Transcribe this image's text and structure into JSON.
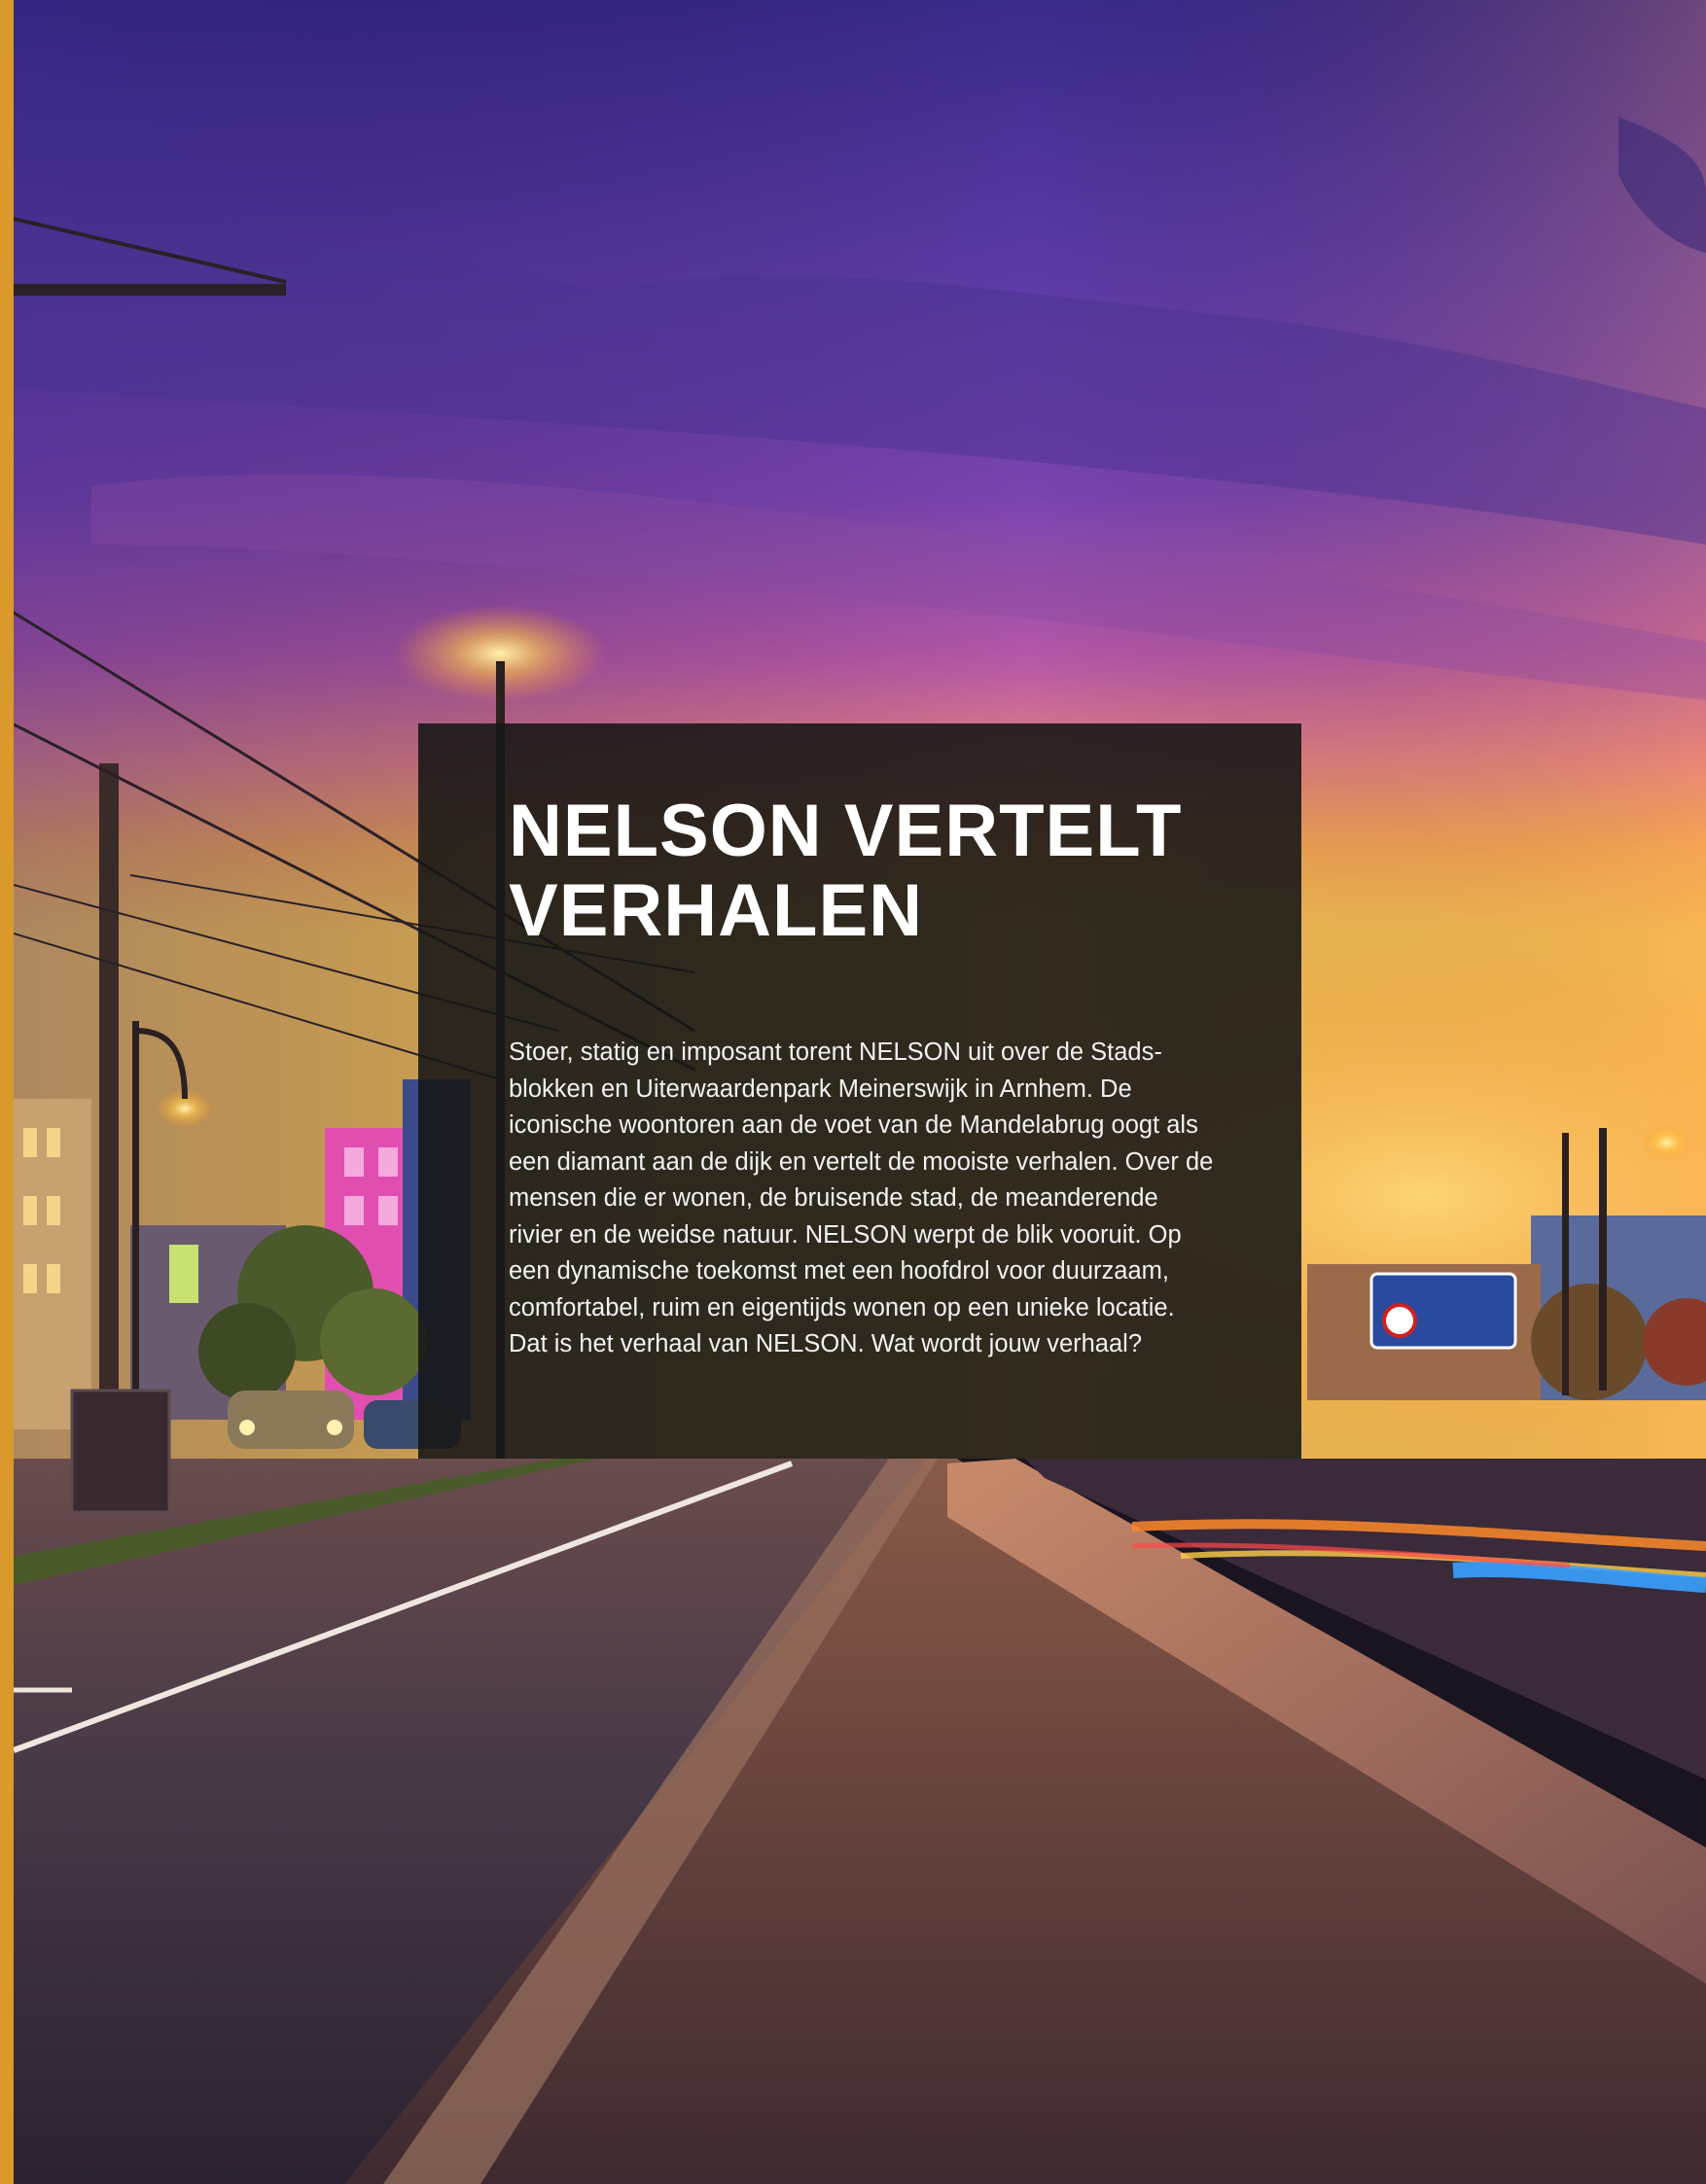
{
  "article": {
    "title": "NELSON VERTELT VERHALEN",
    "body": "Stoer, statig en imposant torent NELSON uit over de Stads-blokken en Uiterwaardenpark Meinerswijk in Arnhem. De iconische woontoren aan de voet van de Mandelabrug oogt als een diamant aan de dijk en vertelt de mooiste verhalen. Over de mensen die er wonen, de bruisende stad, de meanderende rivier en de weidse natuur. NELSON werpt de blik vooruit. Op een dynamische toekomst met een hoofdrol voor duurzaam, comfortabel, ruim en eigentijds wonen op een unieke locatie. Dat is het verhaal van NELSON. Wat wordt jouw verhaal?"
  },
  "colors": {
    "accent_bar": "#d99a2b",
    "panel": "#161616",
    "sky_top": "#3d2d8f",
    "sky_horizon": "#f2b347"
  }
}
